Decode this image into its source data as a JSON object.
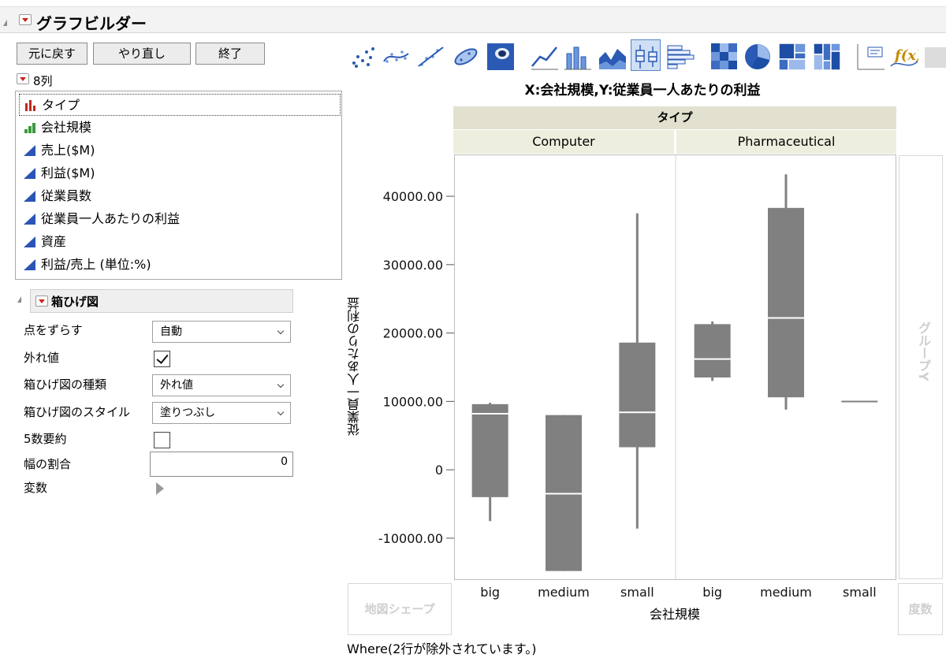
{
  "window": {
    "title": "グラフビルダー"
  },
  "buttons": {
    "undo": "元に戻す",
    "redo": "やり直し",
    "done": "終了"
  },
  "columns": {
    "count_label": "8列",
    "items": [
      {
        "label": "タイプ",
        "type": "nominal"
      },
      {
        "label": "会社規模",
        "type": "ordinal"
      },
      {
        "label": "売上($M)",
        "type": "continuous"
      },
      {
        "label": "利益($M)",
        "type": "continuous"
      },
      {
        "label": "従業員数",
        "type": "continuous"
      },
      {
        "label": "従業員一人あたりの利益",
        "type": "continuous"
      },
      {
        "label": "資産",
        "type": "continuous"
      },
      {
        "label": "利益/売上 (単位:%)",
        "type": "continuous"
      }
    ]
  },
  "boxplot_panel": {
    "title": "箱ひげ図",
    "jitter": {
      "label": "点をずらす",
      "value": "自動"
    },
    "outliers": {
      "label": "外れ値",
      "checked": true
    },
    "box_type": {
      "label": "箱ひげ図の種類",
      "value": "外れ値"
    },
    "box_style": {
      "label": "箱ひげ図のスタイル",
      "value": "塗りつぶし"
    },
    "five_number": {
      "label": "5数要約",
      "checked": false
    },
    "width_ratio": {
      "label": "幅の割合",
      "value": "0"
    },
    "variables": {
      "label": "変数"
    }
  },
  "toolbar": {
    "icons": [
      "points-icon",
      "smoother-icon",
      "line-of-fit-icon",
      "ellipse-icon",
      "contour-icon",
      "line-icon",
      "bar-icon",
      "area-icon",
      "box-plot-icon",
      "histogram-icon",
      "heatmap-icon",
      "pie-icon",
      "treemap-icon",
      "mosaic-icon",
      "caption-box-icon",
      "formula-icon",
      "extra-icon"
    ],
    "active": "box-plot-icon"
  },
  "drop_zones": {
    "group_y": "グループY",
    "map_shape": "地図シェープ",
    "freq": "度数"
  },
  "footer": {
    "where": "Where(2行が除外されています。)"
  },
  "colors": {
    "box_fill": "#808080",
    "median": "#ffffff",
    "panel_header": "#e2e1d0",
    "subheader": "#eeeedf"
  },
  "chart_data": {
    "type": "box",
    "title": "X:会社規模,Y:従業員一人あたりの利益",
    "panel_variable": "タイプ",
    "xlabel": "会社規模",
    "ylabel": "従業員一人あたりの利益",
    "ylim": [
      -16000,
      46000
    ],
    "yticks": [
      -10000,
      0,
      10000,
      20000,
      30000,
      40000
    ],
    "ytick_labels": [
      "-10000.00",
      "0",
      "10000.00",
      "20000.00",
      "30000.00",
      "40000.00"
    ],
    "panels": [
      {
        "name": "Computer",
        "categories": [
          "big",
          "medium",
          "small"
        ],
        "boxes": [
          {
            "min": -7500,
            "q1": -4000,
            "median": 8200,
            "q3": 9600,
            "max": 9800
          },
          {
            "min": -14800,
            "q1": -14800,
            "median": -3500,
            "q3": 8000,
            "max": 8000
          },
          {
            "min": -8600,
            "q1": 3300,
            "median": 8400,
            "q3": 18600,
            "max": 37500
          }
        ]
      },
      {
        "name": "Pharmaceutical",
        "categories": [
          "big",
          "medium",
          "small"
        ],
        "boxes": [
          {
            "min": 13000,
            "q1": 13500,
            "median": 16200,
            "q3": 21300,
            "max": 21700
          },
          {
            "min": 8800,
            "q1": 10600,
            "median": 22200,
            "q3": 38300,
            "max": 43200
          },
          {
            "min": 10100,
            "q1": 10100,
            "median": 10100,
            "q3": 10100,
            "max": 10100
          }
        ]
      }
    ]
  }
}
